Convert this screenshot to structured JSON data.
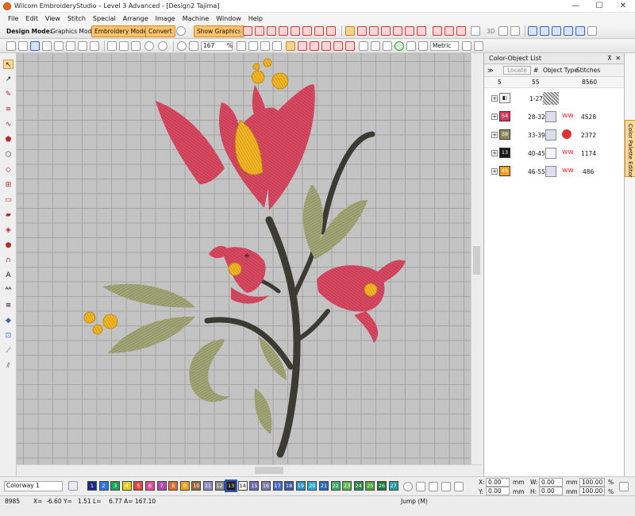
{
  "window": {
    "title": "Wilcom EmbroideryStudio – Level 3 Advanced - [Design2          Tajima]",
    "minimize": "—",
    "maximize": "☐",
    "close": "✕"
  },
  "menu": [
    "File",
    "Edit",
    "View",
    "Stitch",
    "Special",
    "Arrange",
    "Image",
    "Machine",
    "Window",
    "Help"
  ],
  "toolbar1": {
    "design_mode_label": "Design Mode:",
    "graphics_mode": "Graphics Mode",
    "embroidery_mode": "Embroidery Mode",
    "convert": "Convert",
    "show_graphics": "Show Graphics",
    "three_d": "3D"
  },
  "toolbar2": {
    "zoom_value": "167",
    "zoom_unit": "%",
    "units": "Metric"
  },
  "panel": {
    "title": "Color-Object List",
    "locate": "Locate",
    "col_hash": "#",
    "col_object_type": "Object Type",
    "col_stitches": "Stitches",
    "summary": {
      "count": "5",
      "objects": "55",
      "stitches": "8560"
    },
    "rows": [
      {
        "color": "",
        "range": "1-27",
        "stitches": "",
        "chip_color": "#ffffff"
      },
      {
        "color": "54",
        "range": "28-32",
        "stitches": "4528",
        "chip_color": "#d8385a"
      },
      {
        "color": "38",
        "range": "33-39",
        "stitches": "2372",
        "chip_color": "#8b8b5f"
      },
      {
        "color": "13",
        "range": "40-45",
        "stitches": "1174",
        "chip_color": "#1a1a1a"
      },
      {
        "color": "45",
        "range": "46-55",
        "stitches": "486",
        "chip_color": "#f0a020"
      }
    ]
  },
  "side_tab": "Color Palette Editor",
  "colorbar": {
    "colorway": "Colorway 1",
    "swatches": [
      {
        "n": "1",
        "c": "#1b2a8a"
      },
      {
        "n": "2",
        "c": "#2a78d8"
      },
      {
        "n": "3",
        "c": "#1aa35a"
      },
      {
        "n": "4",
        "c": "#e8d020"
      },
      {
        "n": "5",
        "c": "#e04848"
      },
      {
        "n": "6",
        "c": "#e04a9a"
      },
      {
        "n": "7",
        "c": "#b04ab0"
      },
      {
        "n": "8",
        "c": "#e86a2a"
      },
      {
        "n": "9",
        "c": "#f0a020"
      },
      {
        "n": "10",
        "c": "#9a6a3a"
      },
      {
        "n": "11",
        "c": "#8a8ac8"
      },
      {
        "n": "12",
        "c": "#8a8a8a"
      },
      {
        "n": "13",
        "c": "#1a1a1a"
      },
      {
        "n": "14",
        "c": "#f4f4f4"
      },
      {
        "n": "15",
        "c": "#6a6ab8"
      },
      {
        "n": "16",
        "c": "#7a7aa8"
      },
      {
        "n": "17",
        "c": "#4a6ac8"
      },
      {
        "n": "18",
        "c": "#3a5aa8"
      },
      {
        "n": "19",
        "c": "#2a90c8"
      },
      {
        "n": "20",
        "c": "#2aa8d8"
      },
      {
        "n": "21",
        "c": "#2a6ab8"
      },
      {
        "n": "22",
        "c": "#3aa86a"
      },
      {
        "n": "23",
        "c": "#5ab84a"
      },
      {
        "n": "24",
        "c": "#2a8a4a"
      },
      {
        "n": "25",
        "c": "#4aa83a"
      },
      {
        "n": "26",
        "c": "#1a7a3a"
      },
      {
        "n": "27",
        "c": "#2a9aa8"
      }
    ],
    "x_label": "X:",
    "x_val": "0.00",
    "y_label": "Y:",
    "y_val": "0.00",
    "w_label": "W:",
    "w_val": "0.00",
    "h_label": "H:",
    "h_val": "0.00",
    "unit": "mm",
    "pct1": "100.00",
    "pct2": "100.00",
    "pct_unit": "%"
  },
  "status": {
    "stitch_count": "8985",
    "coords": "X=  -6.60 Y=   1.51 L=    6.77 A= 167.10",
    "mode": "Jump (M)"
  },
  "colors": {
    "tulip": "#d84a62",
    "gold": "#f0b41c",
    "leaf": "#9ea270",
    "stem": "#3a3a34"
  }
}
